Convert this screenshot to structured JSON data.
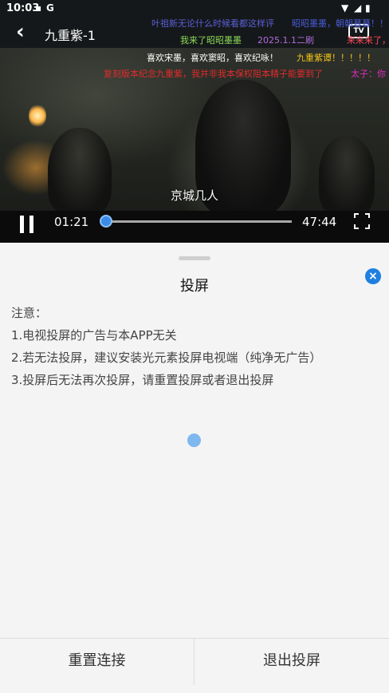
{
  "status_bar": {
    "time": "10:03",
    "left_icons": [
      "sim-card-icon",
      "google-icon"
    ],
    "right_icons": [
      "wifi-icon",
      "signal-icon",
      "battery-icon"
    ]
  },
  "player": {
    "title": "九重紫-1",
    "tv_label": "TV",
    "subtitle": "京城几人",
    "current_time": "01:21",
    "duration": "47:44",
    "progress": 0.028
  },
  "danmaku": [
    {
      "text": "叶祖新无论什么时候看都这样评",
      "color": "#5b5fd6"
    },
    {
      "text": "昭昭墨墨，朝朝暮暮！！",
      "color": "#4a5cd8"
    },
    {
      "text": "我来了昭昭墨墨",
      "color": "#8bdb58"
    },
    {
      "text": "2025.1.1二刷",
      "color": "#b06cdc"
    },
    {
      "text": "来来来了，",
      "color": "#ff4a5a"
    },
    {
      "text": "喜欢宋墨，喜欢窦昭，喜欢纪咏！",
      "color": "#ffffff"
    },
    {
      "text": "九重紫谭！！！！！",
      "color": "#f2c318"
    },
    {
      "text": "复刻版本纪念九重紫，我并非我本保权阻本精子能要到了",
      "color": "#e02c2c"
    },
    {
      "text": "太子：你",
      "color": "#e02cc0"
    }
  ],
  "sheet": {
    "title": "投屏",
    "notes": [
      "注意：",
      "1.电视投屏的广告与本APP无关",
      "2.若无法投屏，建议安装光元素投屏电视端（纯净无广告）",
      "3.投屏后无法再次投屏，请重置投屏或者退出投屏"
    ],
    "reset_label": "重置连接",
    "exit_label": "退出投屏"
  }
}
